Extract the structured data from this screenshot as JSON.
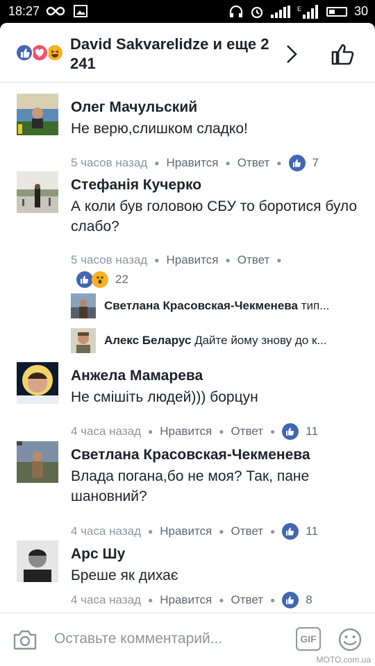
{
  "status_bar": {
    "time": "18:27",
    "battery": "30"
  },
  "header": {
    "title": "David Sakvarelidze и еще 2 241"
  },
  "comments": [
    {
      "name": "Олег Мачульский",
      "text": "Не верю,слишком сладко!",
      "time": "5 часов назад",
      "like": "Нравится",
      "reply": "Ответ",
      "count": "7"
    },
    {
      "name": "Стефанія Кучерко",
      "text": "А коли був головою СБУ то боротися було слабо?",
      "time": "5 часов назад",
      "like": "Нравится",
      "reply": "Ответ",
      "count": "22"
    },
    {
      "name": "Анжела Мамарева",
      "text": "Не смішіть людей))) борцун",
      "time": "4 часа назад",
      "like": "Нравится",
      "reply": "Ответ",
      "count": "11"
    },
    {
      "name": "Светлана Красовская-Чекменева",
      "text": "Влада погана,бо не моя? Так, пане шановний?",
      "time": "4 часа назад",
      "like": "Нравится",
      "reply": "Ответ",
      "count": "11"
    },
    {
      "name": "Арс Шу",
      "text": "Бреше як дихає",
      "time": "4 часа назад",
      "like": "Нравится",
      "reply": "Ответ",
      "count": "8"
    }
  ],
  "replies": [
    {
      "name": "Светлана Красовская-Чекменева",
      "text": "тип..."
    },
    {
      "name": "Алекс Беларус",
      "text": "Дайте йому знову до к..."
    }
  ],
  "composer": {
    "placeholder": "Оставьте комментарий...",
    "gif_label": "GIF"
  },
  "watermark": "MOTO.com.ua",
  "colors": {
    "accent": "#4267b2",
    "love": "#f25268",
    "haha": "#f7b125"
  }
}
